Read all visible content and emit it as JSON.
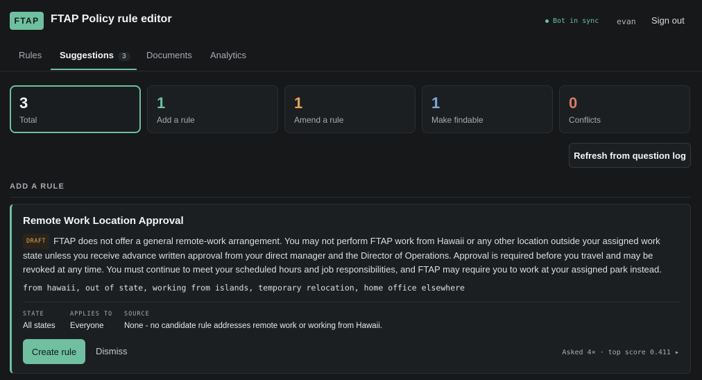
{
  "header": {
    "logo": "FTAP",
    "title": "FTAP Policy rule editor",
    "sync_status": "Bot in sync",
    "user": "evan",
    "sign_out": "Sign out"
  },
  "tabs": [
    {
      "label": "Rules"
    },
    {
      "label": "Suggestions",
      "count": "3"
    },
    {
      "label": "Documents"
    },
    {
      "label": "Analytics"
    }
  ],
  "stats": [
    {
      "value": "3",
      "label": "Total",
      "color": "#f2f3f4"
    },
    {
      "value": "1",
      "label": "Add a rule",
      "color": "#6fbfa0"
    },
    {
      "value": "1",
      "label": "Amend a rule",
      "color": "#e0a85a"
    },
    {
      "value": "1",
      "label": "Make findable",
      "color": "#7ea9d6"
    },
    {
      "value": "0",
      "label": "Conflicts",
      "color": "#d97a6a"
    }
  ],
  "refresh_button": "Refresh from question log",
  "section_heading": "ADD A RULE",
  "suggestion": {
    "title": "Remote Work Location Approval",
    "badge": "DRAFT",
    "body": "FTAP does not offer a general remote-work arrangement. You may not perform FTAP work from Hawaii or any other location outside your assigned work state unless you receive advance written approval from your direct manager and the Director of Operations. Approval is required before you travel and may be revoked at any time. You must continue to meet your scheduled hours and job responsibilities, and FTAP may require you to work at your assigned park instead.",
    "keywords": "from hawaii, out of state, working from islands, temporary relocation, home office elsewhere",
    "meta": {
      "state_label": "STATE",
      "state_value": "All states",
      "applies_label": "APPLIES TO",
      "applies_value": "Everyone",
      "source_label": "SOURCE",
      "source_value": "None - no candidate rule addresses remote work or working from Hawaii."
    },
    "create_button": "Create rule",
    "dismiss_button": "Dismiss",
    "asked_info": "Asked 4× · top score 0.411 ▸"
  }
}
